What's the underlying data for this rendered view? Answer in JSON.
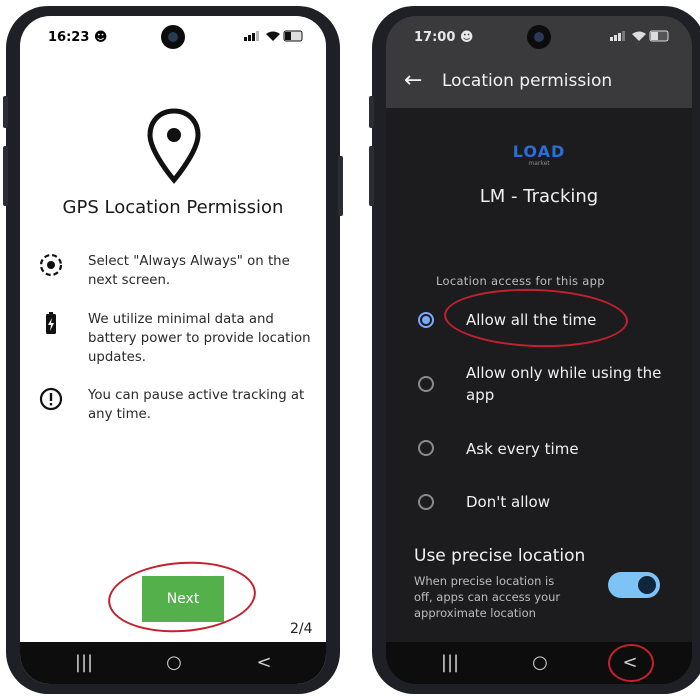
{
  "left_phone": {
    "status": {
      "time": "16:23",
      "icons": "signal wifi battery",
      "battery": "25"
    },
    "title": "GPS Location Permission",
    "info_items": [
      {
        "icon": "location-target-icon",
        "text": "Select \"Always Always\" on the next screen."
      },
      {
        "icon": "battery-icon",
        "text": "We utilize minimal data and battery power to provide location updates."
      },
      {
        "icon": "alert-circle-icon",
        "text": "You can pause active tracking at any time."
      }
    ],
    "next_label": "Next",
    "step": "2/4",
    "nav": {
      "recents": "|||",
      "home": "○",
      "back": "<"
    }
  },
  "right_phone": {
    "status": {
      "time": "17:00"
    },
    "appbar_title": "Location permission",
    "logo_text": "LOAD",
    "logo_sub": "market",
    "app_name": "LM - Tracking",
    "section_label": "Location access for this app",
    "options": [
      {
        "label": "Allow all the time",
        "selected": true
      },
      {
        "label": "Allow only while using the app",
        "selected": false
      },
      {
        "label": "Ask every time",
        "selected": false
      },
      {
        "label": "Don't allow",
        "selected": false
      }
    ],
    "precise": {
      "title": "Use precise location",
      "desc": "When precise location is off, apps can access your approximate location",
      "enabled": true
    },
    "nav": {
      "recents": "|||",
      "home": "○",
      "back": "<"
    }
  },
  "colors": {
    "accent_green": "#54b04a",
    "annotation_red": "#c3212c",
    "radio_blue": "#7aa8ff",
    "toggle_blue": "#7ec3f5"
  }
}
